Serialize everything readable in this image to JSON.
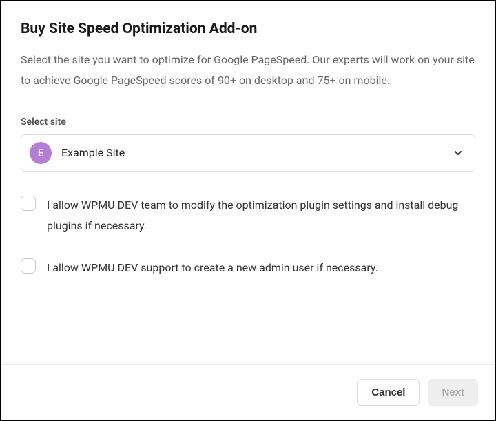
{
  "dialog": {
    "title": "Buy Site Speed Optimization Add-on",
    "description": "Select the site you want to optimize for Google PageSpeed. Our experts will work on your site to achieve Google PageSpeed scores of 90+ on desktop and 75+ on mobile."
  },
  "siteSelect": {
    "label": "Select site",
    "avatarLetter": "E",
    "selected": "Example Site"
  },
  "consents": {
    "modifyPlugins": "I allow WPMU DEV team to modify the optimization plugin settings and install debug plugins if necessary.",
    "createAdmin": "I allow WPMU DEV support to create a new admin user if necessary."
  },
  "actions": {
    "cancel": "Cancel",
    "next": "Next"
  }
}
